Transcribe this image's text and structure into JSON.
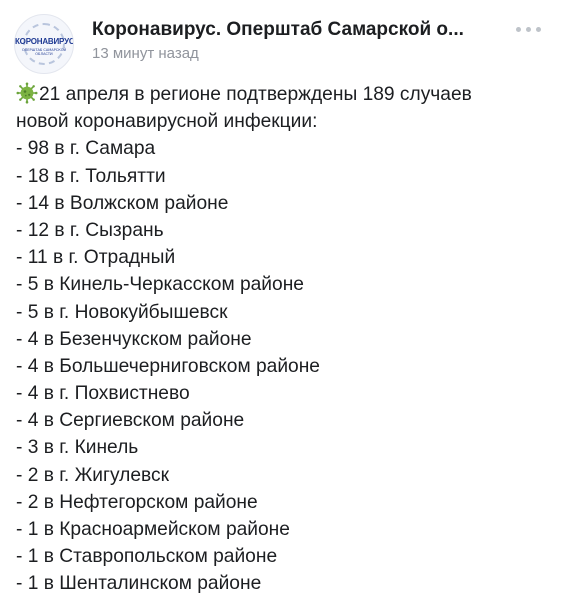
{
  "post": {
    "author": {
      "name": "Коронавирус. Оперштаб Самарской о...",
      "avatar_title": "КОРОНАВИРУС",
      "avatar_subtitle": "ОПЕРШТАБ САМАРСКОЙ ОБЛАСТИ"
    },
    "timestamp": "13 минут назад",
    "more_icon": "more-dots-icon",
    "lead_icon": "virus-icon",
    "lead_line_1": "21 апреля в регионе подтверждены 189 случаев",
    "lead_line_2": "новой коронавирусной инфекции:",
    "cases": [
      "- 98 в г. Самара",
      "- 18 в г. Тольятти",
      "- 14 в Волжском районе",
      "- 12 в г. Сызрань",
      "- 11 в г. Отрадный",
      "- 5 в Кинель-Черкасском районе",
      "- 5 в г. Новокуйбышевск",
      "- 4 в Безенчукском районе",
      "- 4 в Большечерниговском районе",
      "- 4 в г. Похвистнево",
      "- 4 в Сергиевском районе",
      "- 3 в г. Кинель",
      "- 2 в г. Жигулевск",
      "- 2 в Нефтегорском районе",
      "- 1 в Красноармейском районе",
      "- 1 в Ставропольском районе",
      "- 1 в Шенталинском районе"
    ]
  },
  "colors": {
    "text": "#1c1e21",
    "meta": "#90949c",
    "brand": "#1f3a93",
    "virus": "#6ba43a"
  }
}
